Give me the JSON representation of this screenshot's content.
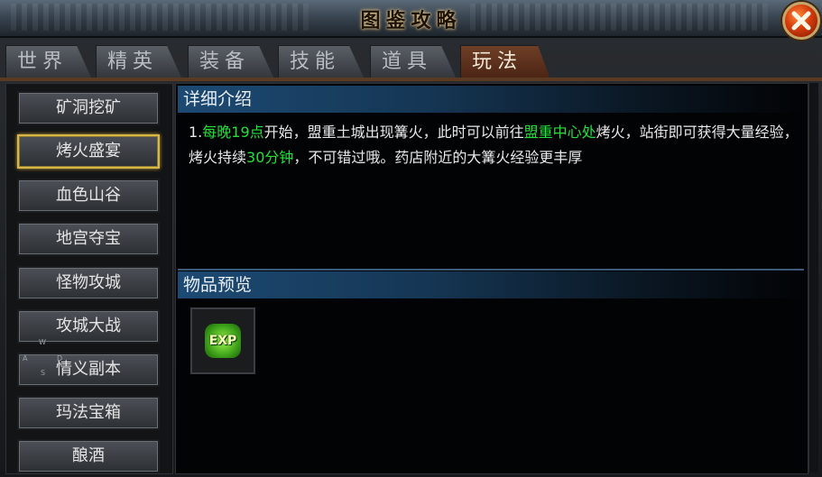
{
  "window": {
    "title": "图鉴攻略",
    "close_icon": "close-x-icon"
  },
  "tabs": [
    {
      "label": "世界",
      "active": false
    },
    {
      "label": "精英",
      "active": false
    },
    {
      "label": "装备",
      "active": false
    },
    {
      "label": "技能",
      "active": false
    },
    {
      "label": "道具",
      "active": false
    },
    {
      "label": "玩法",
      "active": true
    }
  ],
  "sidebar": {
    "selected": "烤火盛宴",
    "items": [
      {
        "label": "矿洞挖矿"
      },
      {
        "label": "烤火盛宴"
      },
      {
        "label": "血色山谷"
      },
      {
        "label": "地宫夺宝"
      },
      {
        "label": "怪物攻城"
      },
      {
        "label": "攻城大战"
      },
      {
        "label": "情义副本"
      },
      {
        "label": "玛法宝箱"
      },
      {
        "label": "酿酒"
      }
    ]
  },
  "detail": {
    "heading": "详细介绍",
    "segments": [
      {
        "text": "1.",
        "highlight": false
      },
      {
        "text": "每晚19点",
        "highlight": true
      },
      {
        "text": "开始，盟重土城出现篝火，此时可以前往",
        "highlight": false
      },
      {
        "text": "盟重中心处",
        "highlight": true
      },
      {
        "text": "烤火，站街即可获得大量经验，烤火持续",
        "highlight": false
      },
      {
        "text": "30分钟",
        "highlight": true
      },
      {
        "text": "，不可错过哦。药店附近的大篝火经验更丰厚",
        "highlight": false
      }
    ]
  },
  "preview": {
    "heading": "物品预览",
    "items": [
      {
        "icon": "exp-orb-icon",
        "label": "EXP"
      }
    ]
  },
  "overlay_keys": {
    "w": "W",
    "a": "A",
    "d": "D",
    "s": "S"
  },
  "colors": {
    "highlight_green": "#22e03a",
    "active_tab": "#4b2414",
    "selected_border": "#d8b64a",
    "section_header_blue": "#1d4a73"
  }
}
